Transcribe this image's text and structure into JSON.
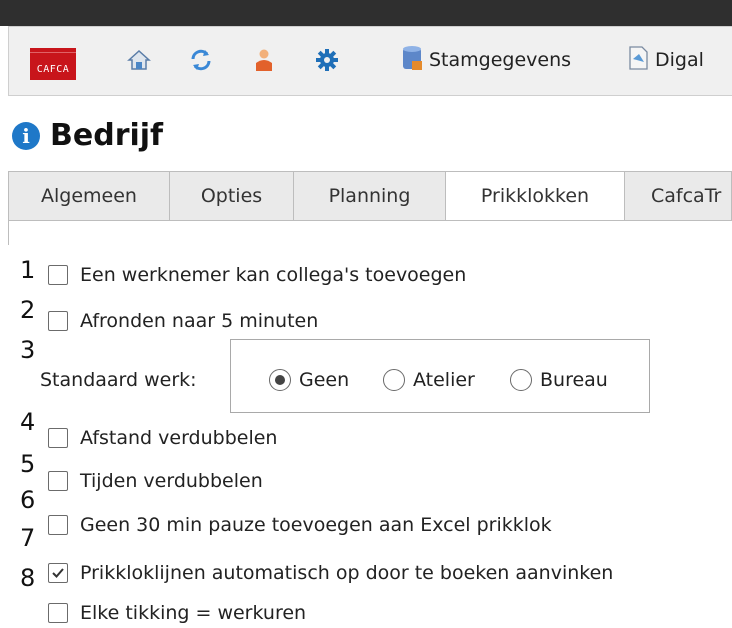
{
  "toolbar": {
    "logo_text": "CAFCA",
    "icons": [
      "home-icon",
      "refresh-icon",
      "user-icon",
      "gear-icon"
    ],
    "stamgegevens_label": "Stamgegevens",
    "digital_label": "Digal"
  },
  "page": {
    "title": "Bedrijf"
  },
  "tabs": [
    "Algemeen",
    "Opties",
    "Planning",
    "Prikklokken",
    "CafcaTr"
  ],
  "active_tab": "Prikklokken",
  "annotations": [
    "1",
    "2",
    "3",
    "4",
    "5",
    "6",
    "7",
    "8"
  ],
  "options": [
    {
      "label": "Een werknemer kan collega's toevoegen",
      "checked": false
    },
    {
      "label": "Afronden naar 5 minuten",
      "checked": false
    },
    {
      "label": "Afstand verdubbelen",
      "checked": false
    },
    {
      "label": "Tijden verdubbelen",
      "checked": false
    },
    {
      "label": "Geen 30 min pauze toevoegen aan Excel prikklok",
      "checked": false
    },
    {
      "label": "Prikkloklijnen automatisch op door te boeken aanvinken",
      "checked": true
    },
    {
      "label": "Elke tikking = werkuren",
      "checked": false
    }
  ],
  "standaard_werk": {
    "label": "Standaard werk:",
    "options": [
      "Geen",
      "Atelier",
      "Bureau"
    ],
    "selected": "Geen"
  }
}
